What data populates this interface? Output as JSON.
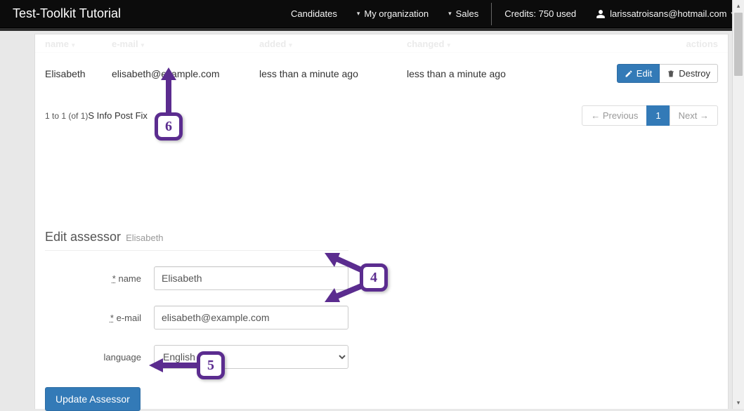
{
  "navbar": {
    "brand": "Test-Toolkit Tutorial",
    "candidates": "Candidates",
    "my_org": "My organization",
    "sales": "Sales",
    "credits": "Credits: 750 used",
    "user_email": "larissatroisans@hotmail.com"
  },
  "table": {
    "headers": {
      "name": "name",
      "email": "e-mail",
      "added": "added",
      "changed": "changed",
      "actions": "actions"
    },
    "row": {
      "name": "Elisabeth",
      "email": "elisabeth@example.com",
      "added": "less than a minute ago",
      "changed": "less than a minute ago"
    },
    "edit_label": "Edit",
    "destroy_label": "Destroy",
    "footer_count": "1 to 1 (of 1)",
    "footer_fix": "S Info Post Fix",
    "pagination": {
      "prev": "← Previous",
      "current": "1",
      "next": "Next →"
    }
  },
  "form": {
    "title": "Edit assessor",
    "subtitle": "Elisabeth",
    "name_label": "name",
    "name_value": "Elisabeth",
    "email_label": "e-mail",
    "email_value": "elisabeth@example.com",
    "language_label": "language",
    "language_value": "English",
    "submit": "Update Assessor",
    "req_marker": "*"
  },
  "annotations": {
    "c4": "4",
    "c5": "5",
    "c6": "6"
  }
}
